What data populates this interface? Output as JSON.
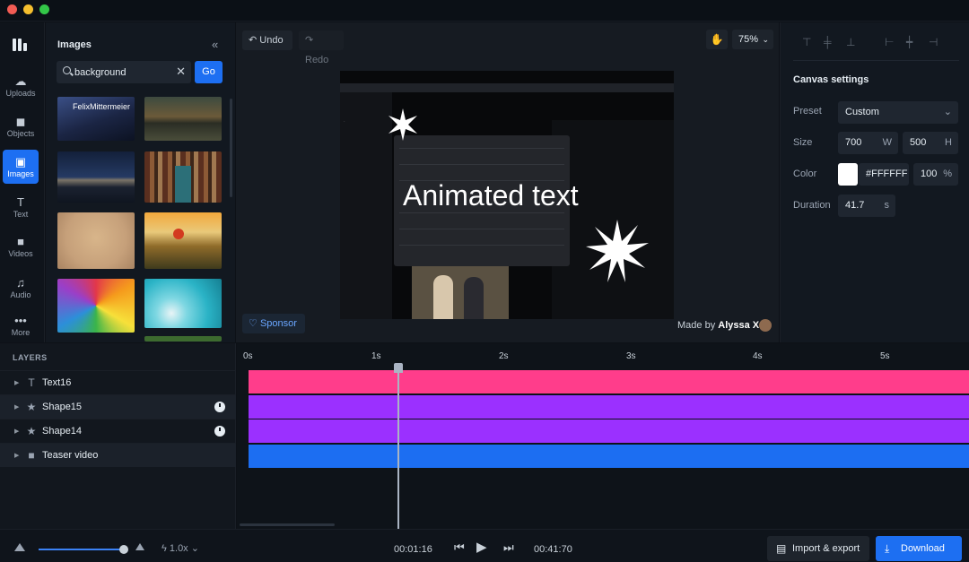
{
  "sidebar": {
    "items": [
      {
        "label": "Uploads",
        "icon": "cloud-upload-icon"
      },
      {
        "label": "Objects",
        "icon": "shapes-icon"
      },
      {
        "label": "Images",
        "icon": "image-icon"
      },
      {
        "label": "Text",
        "icon": "text-icon"
      },
      {
        "label": "Videos",
        "icon": "video-icon"
      },
      {
        "label": "Audio",
        "icon": "music-icon"
      },
      {
        "label": "More",
        "icon": "more-icon"
      }
    ],
    "active": "Images"
  },
  "images_panel": {
    "title": "Images",
    "search_value": "background",
    "go_label": "Go",
    "first_caption": "FelixMittermeier"
  },
  "toolbar": {
    "undo_label": "Undo",
    "redo_label": "Redo",
    "zoom": "75%"
  },
  "canvas": {
    "text": "Animated text",
    "sponsor_label": "Sponsor",
    "made_by_prefix": "Made by",
    "made_by_name": "Alyssa X"
  },
  "canvas_settings": {
    "title": "Canvas settings",
    "preset_label": "Preset",
    "preset_value": "Custom",
    "size_label": "Size",
    "width": "700",
    "width_unit": "W",
    "height": "500",
    "height_unit": "H",
    "color_label": "Color",
    "color_value": "#FFFFFF",
    "opacity": "100",
    "opacity_unit": "%",
    "duration_label": "Duration",
    "duration": "41.7",
    "duration_unit": "s"
  },
  "layers": {
    "header": "LAYERS",
    "items": [
      {
        "name": "Text16",
        "icon": "text-icon",
        "timed": false
      },
      {
        "name": "Shape15",
        "icon": "star-icon",
        "timed": true
      },
      {
        "name": "Shape14",
        "icon": "star-icon",
        "timed": true
      },
      {
        "name": "Teaser video",
        "icon": "video-icon",
        "timed": false
      }
    ]
  },
  "timeline": {
    "ticks": [
      "0s",
      "1s",
      "2s",
      "3s",
      "4s",
      "5s"
    ],
    "track_colors": [
      "#ff3d8b",
      "#9b30ff",
      "#9b30ff",
      "#1c6ef2"
    ]
  },
  "playback": {
    "speed": "1.0x",
    "current_time": "00:01:16",
    "total_time": "00:41:70",
    "import_export_label": "Import & export",
    "download_label": "Download"
  },
  "colors": {
    "accent": "#1d6ff2",
    "background": "#0d1117"
  }
}
